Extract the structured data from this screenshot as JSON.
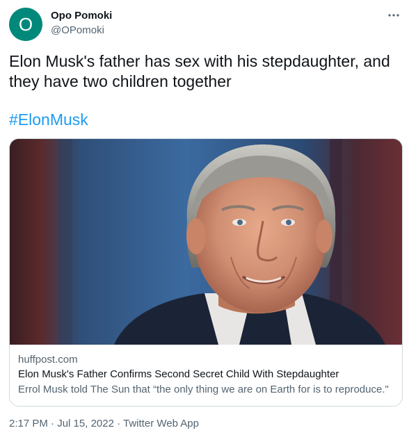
{
  "author": {
    "avatar_initial": "O",
    "avatar_color": "#00897b",
    "display_name": "Opo Pomoki",
    "handle": "@OPomoki"
  },
  "more_icon": "more-horizontal-icon",
  "tweet": {
    "text": "Elon Musk's father has sex with his stepdaughter, and they have two children together",
    "hashtag": "#ElonMusk"
  },
  "card": {
    "image": "portrait photo of an older man with grey hair in a dark jacket",
    "domain": "huffpost.com",
    "title": "Elon Musk's Father Confirms Second Secret Child With Stepdaughter",
    "description": "Errol Musk told The Sun that “the only thing we are on Earth for is to reproduce.\""
  },
  "meta": {
    "time": "2:17 PM",
    "separator_1": " · ",
    "date": "Jul 15, 2022",
    "separator_2": " · ",
    "source": "Twitter Web App"
  },
  "colors": {
    "link": "#1d9bf0",
    "secondary_text": "#536471",
    "primary_text": "#0f1419",
    "card_border": "#cfd9de"
  }
}
